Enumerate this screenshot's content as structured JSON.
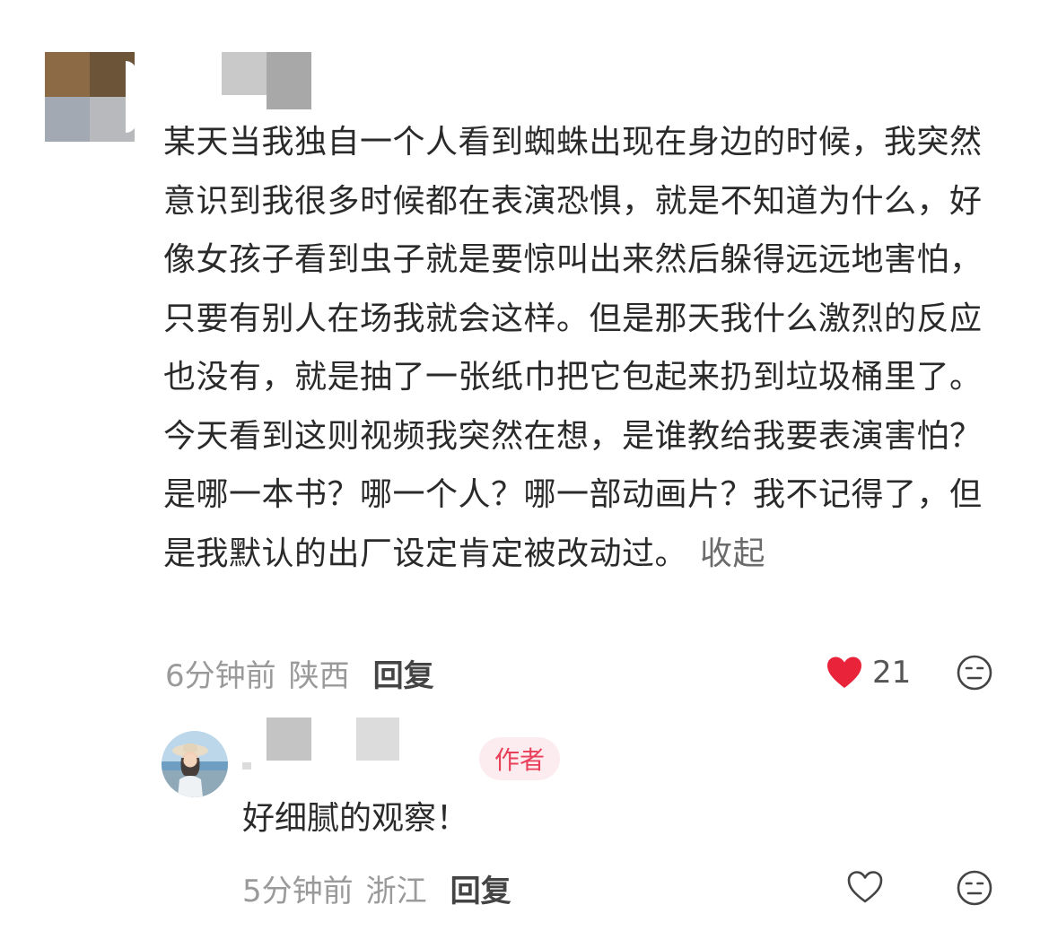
{
  "comment": {
    "text": "某天当我独自一个人看到蜘蛛出现在身边的时候，我突然意识到我很多时候都在表演恐惧，就是不知道为什么，好像女孩子看到虫子就是要惊叫出来然后躲得远远地害怕，只要有别人在场我就会这样。但是那天我什么激烈的反应也没有，就是抽了一张纸巾把它包起来扔到垃圾桶里了。今天看到这则视频我突然在想，是谁教给我要表演害怕？是哪一本书？哪一个人？哪一部动画片？我不记得了，但是我默认的出厂设定肯定被改动过。",
    "collapse_label": "收起",
    "time": "6分钟前",
    "region": "陕西",
    "reply_label": "回复",
    "like_count": "21",
    "liked": true
  },
  "reply": {
    "badge": "作者",
    "text": "好细腻的观察！",
    "time": "5分钟前",
    "region": "浙江",
    "reply_label": "回复",
    "liked": false
  },
  "icons": {
    "heart_filled": "heart-filled-icon",
    "heart_outline": "heart-outline-icon",
    "dislike": "neutral-face-icon"
  },
  "colors": {
    "like_red": "#e8233a",
    "badge_bg": "#fdecef",
    "badge_text": "#e8405a"
  }
}
